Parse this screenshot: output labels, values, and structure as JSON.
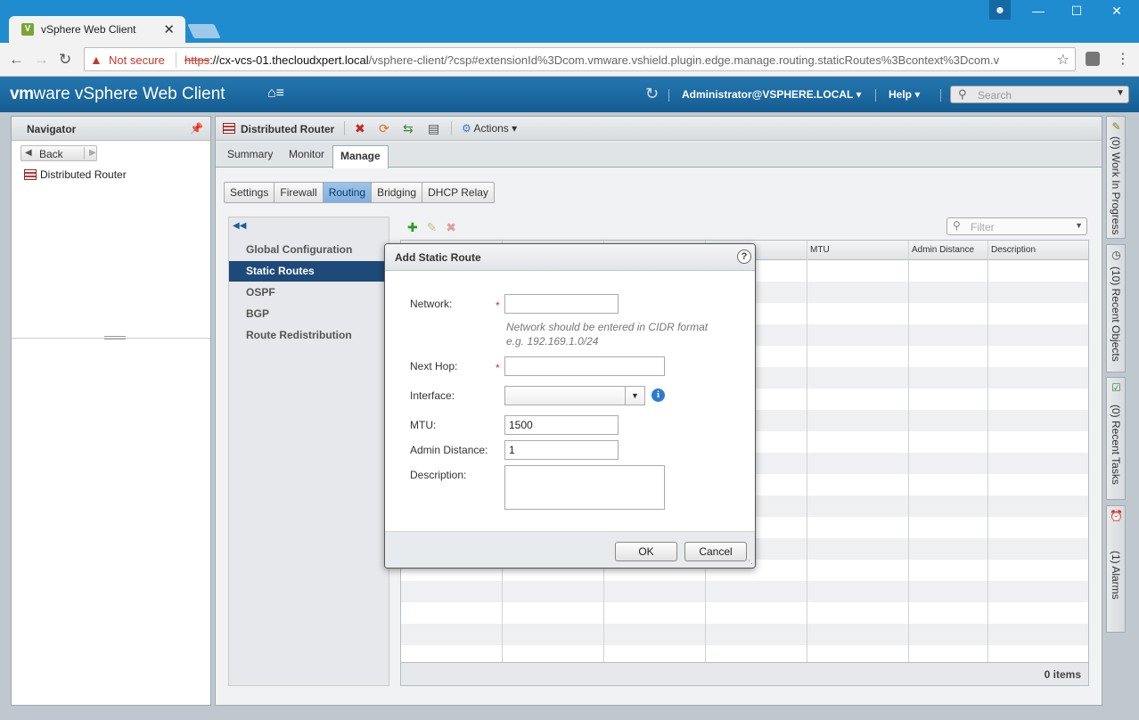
{
  "browser": {
    "tab_title": "vSphere Web Client",
    "tab_close": "✕",
    "security_label": "Not secure",
    "url_scheme": "https",
    "url_host": "://cx-vcs-01.thecloudxpert.local",
    "url_path": "/vsphere-client/?csp#extensionId%3Dcom.vmware.vshield.plugin.edge.manage.routing.staticRoutes%3Bcontext%3Dcom.v"
  },
  "header": {
    "brand_vm": "vm",
    "brand_ware": "ware",
    "brand_product": " vSphere Web Client",
    "user": "Administrator@VSPHERE.LOCAL",
    "help": "Help",
    "search_placeholder": "Search"
  },
  "navigator": {
    "title": "Navigator",
    "back": "Back",
    "item": "Distributed Router"
  },
  "content": {
    "title": "Distributed Router",
    "actions": "Actions",
    "tabs": [
      "Summary",
      "Monitor",
      "Manage"
    ],
    "subtabs": [
      "Settings",
      "Firewall",
      "Routing",
      "Bridging",
      "DHCP Relay"
    ],
    "leftnav": [
      "Global Configuration",
      "Static Routes",
      "OSPF",
      "BGP",
      "Route Redistribution"
    ],
    "filter_placeholder": "Filter",
    "columns": [
      "MTU",
      "Admin Distance",
      "Description"
    ],
    "item_count": "0 items"
  },
  "rightbar": {
    "work_in_progress": "(0)  Work In Progress",
    "recent_objects": "(10)  Recent Objects",
    "recent_tasks": "(0)  Recent Tasks",
    "alarms": "(1)  Alarms"
  },
  "dialog": {
    "title": "Add Static Route",
    "network_label": "Network:",
    "network_value": "",
    "hint_line1": "Network should be entered in CIDR format",
    "hint_line2": "e.g. 192.169.1.0/24",
    "nexthop_label": "Next Hop:",
    "nexthop_value": "",
    "interface_label": "Interface:",
    "mtu_label": "MTU:",
    "mtu_value": "1500",
    "admin_distance_label": "Admin Distance:",
    "admin_distance_value": "1",
    "description_label": "Description:",
    "description_value": "",
    "ok": "OK",
    "cancel": "Cancel",
    "required_mark": "*"
  }
}
